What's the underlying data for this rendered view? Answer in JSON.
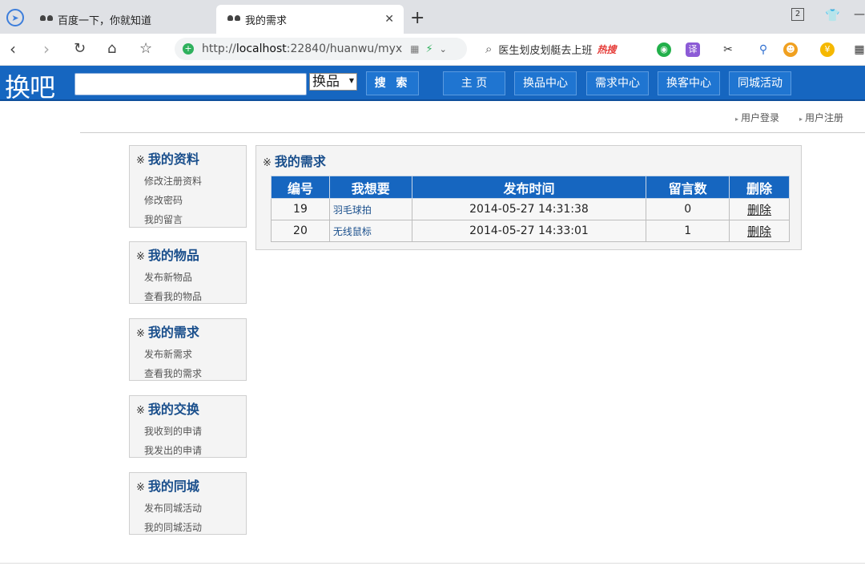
{
  "browser": {
    "tabs": [
      {
        "title": "百度一下，你就知道"
      },
      {
        "title": "我的需求"
      }
    ],
    "tab_count": "2",
    "url": {
      "prefix": "http://",
      "host": "localhost",
      "rest": ":22840/huanwu/myx"
    },
    "search_hint": "医生划皮划艇去上班",
    "hot_label": "热搜",
    "icons": {
      "back": "back-arrow-icon",
      "forward": "forward-arrow-icon",
      "reload": "reload-icon",
      "home": "home-icon",
      "bookmark": "star-icon",
      "close_tab": "close-icon",
      "new_tab": "plus-icon"
    }
  },
  "site": {
    "logo": "换吧",
    "search_value": "",
    "category_select": "换品",
    "search_button": "搜 索",
    "nav": [
      {
        "label": "主 页"
      },
      {
        "label": "换品中心"
      },
      {
        "label": "需求中心"
      },
      {
        "label": "换客中心"
      },
      {
        "label": "同城活动"
      }
    ],
    "user_links": {
      "login": "用户登录",
      "register": "用户注册"
    }
  },
  "sidebar": [
    {
      "title": "我的资料",
      "items": [
        "修改注册资料",
        "修改密码",
        "我的留言"
      ]
    },
    {
      "title": "我的物品",
      "items": [
        "发布新物品",
        "查看我的物品"
      ]
    },
    {
      "title": "我的需求",
      "items": [
        "发布新需求",
        "查看我的需求"
      ]
    },
    {
      "title": "我的交换",
      "items": [
        "我收到的申请",
        "我发出的申请"
      ]
    },
    {
      "title": "我的同城",
      "items": [
        "发布同城活动",
        "我的同城活动"
      ]
    }
  ],
  "main": {
    "title": "我的需求",
    "mark": "※",
    "columns": [
      "编号",
      "我想要",
      "发布时间",
      "留言数",
      "删除"
    ],
    "rows": [
      {
        "id": "19",
        "want": "羽毛球拍",
        "time": "2014-05-27 14:31:38",
        "comments": "0",
        "delete": "删除"
      },
      {
        "id": "20",
        "want": "无线鼠标",
        "time": "2014-05-27 14:33:01",
        "comments": "1",
        "delete": "删除"
      }
    ]
  },
  "colors": {
    "header_blue": "#1666c0",
    "title_blue": "#1a4f8c"
  }
}
